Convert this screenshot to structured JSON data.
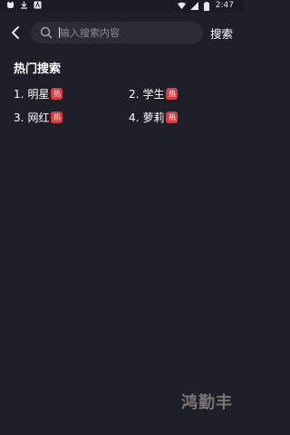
{
  "status_bar": {
    "time": "2:47",
    "left_icons": [
      "cat-notification-icon",
      "download-icon",
      "app-a-icon"
    ],
    "right_icons": [
      "wifi-icon",
      "signal-icon",
      "battery-icon"
    ]
  },
  "header": {
    "search_placeholder": "输入搜索内容",
    "search_button": "搜索"
  },
  "hot_search": {
    "title": "热门搜索",
    "badge": "热",
    "items": [
      {
        "rank": "1.",
        "label": "明星"
      },
      {
        "rank": "2.",
        "label": "学生"
      },
      {
        "rank": "3.",
        "label": "网红"
      },
      {
        "rank": "4.",
        "label": "萝莉"
      }
    ]
  },
  "watermark": "鸿勤丰",
  "colors": {
    "background": "#1e1f29",
    "search_box": "#2b2c38",
    "badge": "#e4393c"
  }
}
